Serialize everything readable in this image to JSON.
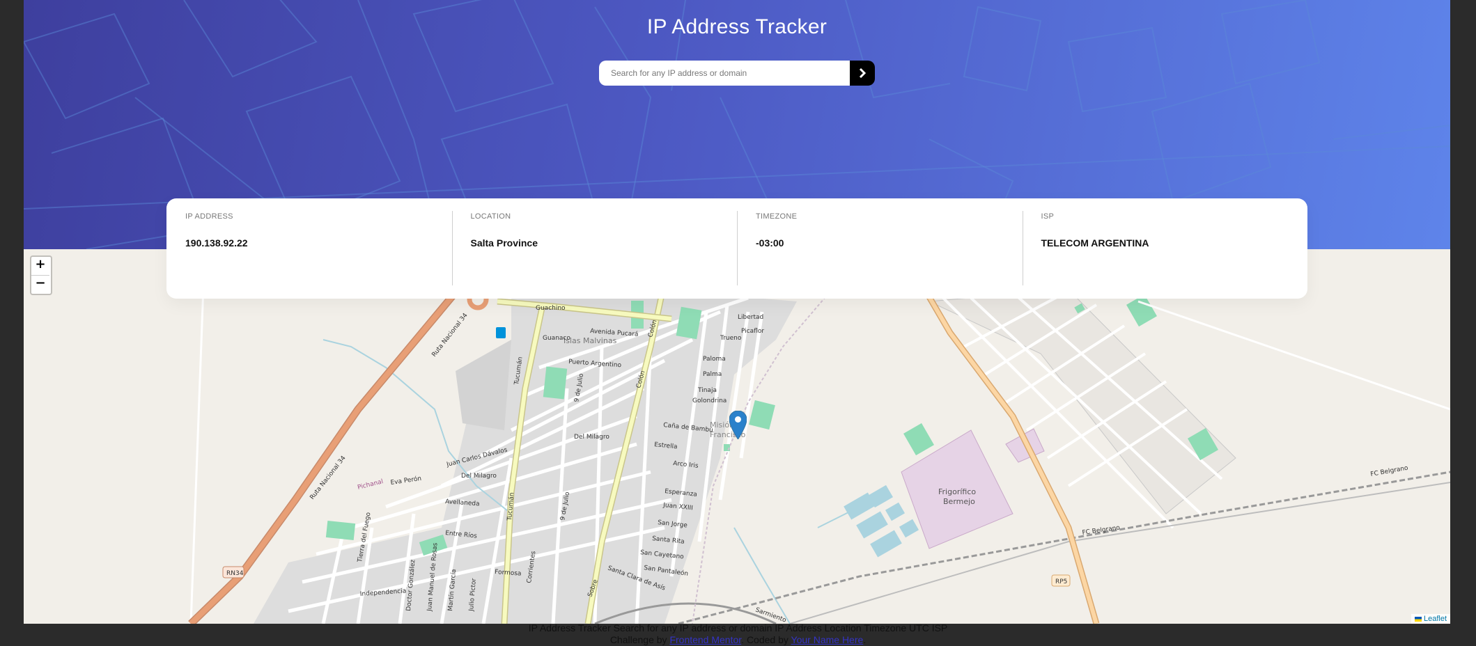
{
  "header": {
    "title": "IP Address Tracker",
    "search_placeholder": "Search for any IP address or domain",
    "submit_icon": "chevron-right-icon"
  },
  "info": [
    {
      "label": "IP Address",
      "value": "190.138.92.22"
    },
    {
      "label": "Location",
      "value": "Salta Province"
    },
    {
      "label": "Timezone",
      "value": "-03:00"
    },
    {
      "label": "ISP",
      "value": "TELECOM ARGENTINA"
    }
  ],
  "map": {
    "zoom_in": "+",
    "zoom_out": "−",
    "marker_icon": "location-pin-icon",
    "attribution": "Leaflet",
    "labels": {
      "avenida_pucara": "Avenida Pucará",
      "islas_malvinas": "Islas Malvinas",
      "ruta_nacional_34": "Ruta Nacional 34",
      "ruta_nacional_34b": "Ruta Nacional 34",
      "tucuman": "Tucumán",
      "colon": "Colón",
      "mision": "Misión",
      "francisco": "Francisco",
      "frigorifico": "Frigorífico",
      "bermejo": "Bermejo",
      "fc_belgrano": "FC Belgrano",
      "fc_belgrano2": "FC Belgrano",
      "rn34": "RN34",
      "rp5": "RP5",
      "del_milagro": "Del Milagro",
      "eva_peron": "Eva Perón",
      "avellaneda": "Avellaneda",
      "entre_rios": "Entre Ríos",
      "independencia": "Independencia",
      "formosa": "Formosa",
      "esperanza": "Esperanza",
      "estrella": "Estrella",
      "san_jorge": "San Jorge",
      "santa_rita": "Santa Rita",
      "san_cayetano": "San Cayetano",
      "san_pantaleon": "San Pantaleón",
      "puerto_argentino": "Puerto Argentino",
      "guachino": "Guachino",
      "libertad": "Libertad",
      "trueno": "Trueno",
      "paloma": "Paloma",
      "tinaja": "Tinaja",
      "golondrina": "Golondrina",
      "juan_xxiii": "Juan XXIII",
      "sarmiento": "Sarmiento",
      "pichanal": "Pichanal",
      "juan_carlos_davalos": "Juan Carlos Dávalos",
      "nueve_de_julio": "9 de Julio",
      "sobre": "Sobre",
      "arco_iris": "Arco Iris",
      "cana_de_bambu": "Caña de Bambú",
      "palma": "Palma",
      "picaflor": "Picaflor",
      "guanaco": "Guanaco",
      "tierra_del_fuego": "Tierra del Fuego",
      "santa_clara": "Santa Clara de Asís",
      "corrientes": "Corrientes",
      "doctor_gonzalez": "Doctor González",
      "juan_manuel_de_rosas": "Juan Manuel de Rosas",
      "martin_garcia": "Martín García",
      "julio_pictor": "Julio Pictor"
    }
  },
  "footer": {
    "line1": "IP Address Tracker Search for any IP address or domain IP Address Location Timezone UTC ISP",
    "challenge_prefix": "Challenge by",
    "challenge_link": "Frontend Mentor",
    "coded_prefix": ". Coded by",
    "coded_link": "Your Name Here",
    "end": "."
  },
  "colors": {
    "header_start": "#3e3f9e",
    "header_end": "#5e84ea",
    "map_background": "#f2efe9",
    "marker": "#2a81cb",
    "primary_road": "#f7fabf",
    "trunk_road": "#e89f76",
    "secondary_road": "#fcd6a4"
  }
}
